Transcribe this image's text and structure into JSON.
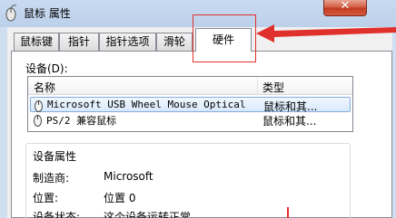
{
  "window": {
    "title": "鼠标 属性",
    "close_label": "✕"
  },
  "tabs": [
    {
      "label": "鼠标键",
      "active": false
    },
    {
      "label": "指针",
      "active": false
    },
    {
      "label": "指针选项",
      "active": false
    },
    {
      "label": "滑轮",
      "active": false
    },
    {
      "label": "硬件",
      "active": true
    }
  ],
  "devices": {
    "label": "设备(D):",
    "columns": {
      "name": "名称",
      "type": "类型"
    },
    "rows": [
      {
        "name": "Microsoft USB Wheel Mouse Optical",
        "type": "鼠标和其...",
        "selected": true,
        "icon": "mouse-icon"
      },
      {
        "name": "PS/2 兼容鼠标",
        "type": "鼠标和其...",
        "selected": false,
        "icon": "mouse-icon"
      }
    ]
  },
  "properties": {
    "title": "设备属性",
    "items": [
      {
        "label": "制造商:",
        "value": "Microsoft"
      },
      {
        "label": "位置:",
        "value": "位置 0"
      },
      {
        "label": "设备状态:",
        "value": "这个设备运转正常。"
      }
    ]
  },
  "annotation": {
    "color": "#e0302c"
  }
}
